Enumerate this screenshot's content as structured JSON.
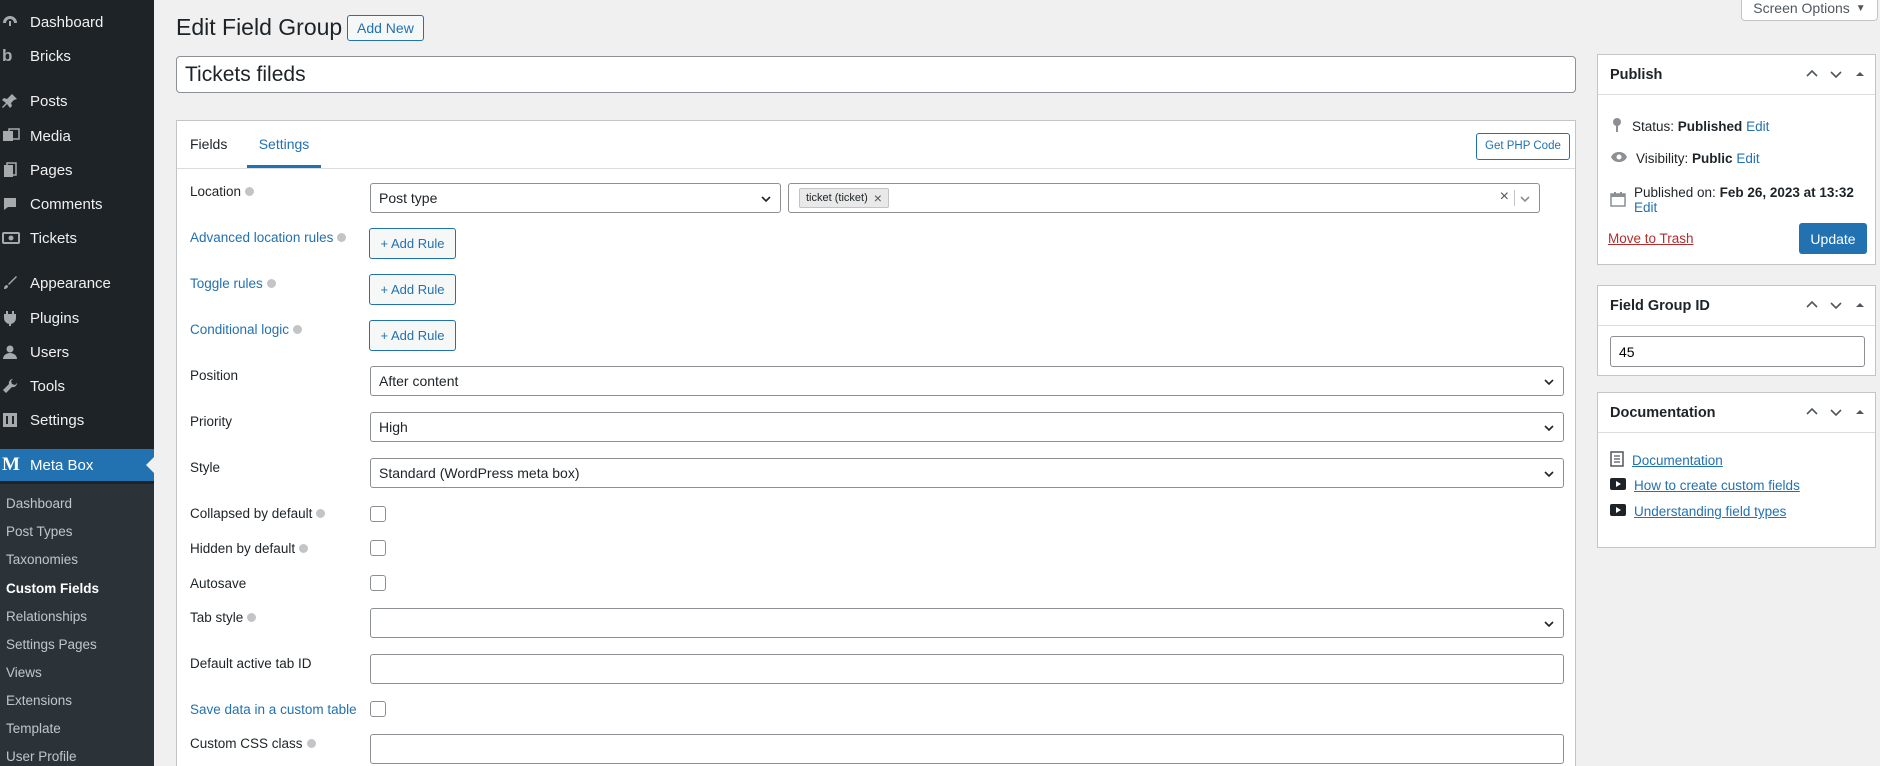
{
  "sidebar": {
    "items": [
      {
        "label": "Dashboard",
        "icon": "dashboard-icon"
      },
      {
        "label": "Bricks",
        "icon": "bricks-logo-icon"
      },
      {
        "label": "Posts",
        "icon": "pin-icon"
      },
      {
        "label": "Media",
        "icon": "media-icon"
      },
      {
        "label": "Pages",
        "icon": "pages-icon"
      },
      {
        "label": "Comments",
        "icon": "comment-icon"
      },
      {
        "label": "Tickets",
        "icon": "ticket-icon"
      },
      {
        "label": "Appearance",
        "icon": "brush-icon"
      },
      {
        "label": "Plugins",
        "icon": "plug-icon"
      },
      {
        "label": "Users",
        "icon": "user-icon"
      },
      {
        "label": "Tools",
        "icon": "wrench-icon"
      },
      {
        "label": "Settings",
        "icon": "settings-icon"
      },
      {
        "label": "Meta Box",
        "icon": "metabox-logo-icon"
      }
    ],
    "submenu": [
      "Dashboard",
      "Post Types",
      "Taxonomies",
      "Custom Fields",
      "Relationships",
      "Settings Pages",
      "Views",
      "Extensions",
      "Template",
      "User Profile"
    ]
  },
  "header": {
    "title": "Edit Field Group",
    "add_new": "Add New",
    "screen_options": "Screen Options"
  },
  "title_field": {
    "value": "Tickets fileds"
  },
  "tabs": [
    "Fields",
    "Settings"
  ],
  "php_button": "Get PHP Code",
  "settings": {
    "location_label": "Location",
    "location_select": "Post type",
    "location_chip": "ticket (ticket)",
    "advanced_rules_label": "Advanced location rules",
    "toggle_rules_label": "Toggle rules",
    "conditional_logic_label": "Conditional logic",
    "add_rule": "+ Add Rule",
    "position_label": "Position",
    "position_value": "After content",
    "priority_label": "Priority",
    "priority_value": "High",
    "style_label": "Style",
    "style_value": "Standard (WordPress meta box)",
    "collapsed_label": "Collapsed by default",
    "hidden_label": "Hidden by default",
    "autosave_label": "Autosave",
    "tab_style_label": "Tab style",
    "default_tab_label": "Default active tab ID",
    "custom_table_label": "Save data in a custom table",
    "css_class_label": "Custom CSS class"
  },
  "publish": {
    "title": "Publish",
    "status_label": "Status:",
    "status_value": "Published",
    "visibility_label": "Visibility:",
    "visibility_value": "Public",
    "published_label": "Published on:",
    "published_value": "Feb 26, 2023 at 13:32",
    "edit": "Edit",
    "trash": "Move to Trash",
    "update": "Update"
  },
  "field_group_id": {
    "title": "Field Group ID",
    "value": "45"
  },
  "documentation": {
    "title": "Documentation",
    "links": [
      "Documentation",
      "How to create custom fields",
      "Understanding field types"
    ]
  }
}
